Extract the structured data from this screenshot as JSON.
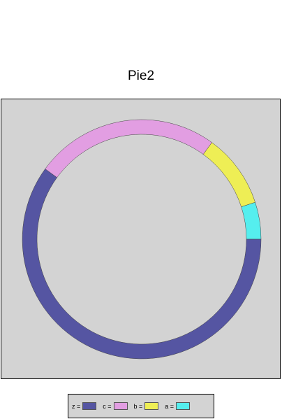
{
  "chart_data": {
    "type": "pie",
    "style": "ring",
    "title": "Pie2",
    "start": "3 o'clock",
    "direction": "counter-clockwise",
    "slices": [
      {
        "label": "a",
        "value": 5,
        "color": "#55eeee"
      },
      {
        "label": "b",
        "value": 10,
        "color": "#eeee55"
      },
      {
        "label": "c",
        "value": 25,
        "color": "#e29ee2"
      },
      {
        "label": "z",
        "value": 60,
        "color": "#5555a2"
      }
    ],
    "legend": {
      "placement": "bottom",
      "order": [
        "z",
        "c",
        "b",
        "a"
      ],
      "suffix": " ="
    },
    "background_color": "#d3d3d3"
  }
}
